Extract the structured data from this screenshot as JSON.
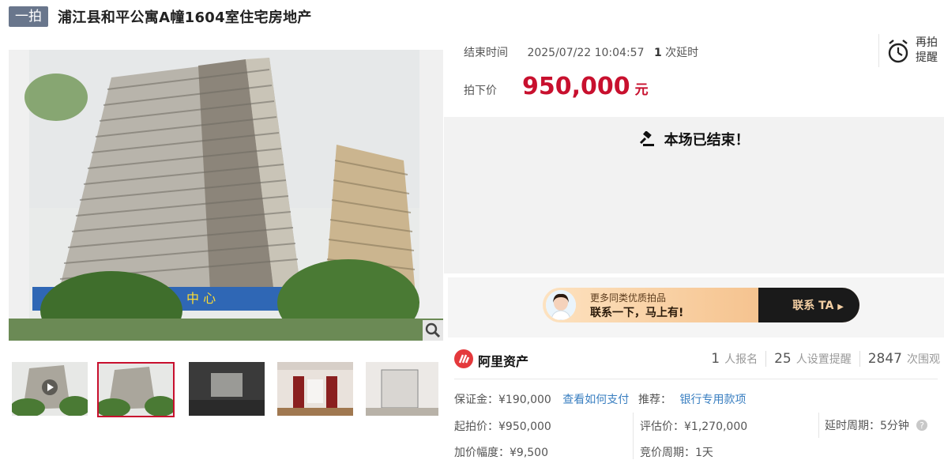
{
  "header": {
    "badge": "一拍",
    "title": "浦江县和平公寓A幢1604室住宅房地产"
  },
  "gallery": {
    "main_image": "building-photo",
    "thumbnail_count": 5,
    "active_thumbnail": 2
  },
  "auction": {
    "end_label": "结束时间",
    "end_time": "2025/07/22 10:04:57",
    "delay_count": "1",
    "delay_suffix": "次延时",
    "remind_label": "再拍提醒",
    "price_label": "拍下价",
    "price": "950,000",
    "price_unit": "元",
    "ended_text": "本场已结束！"
  },
  "promo": {
    "line1": "更多同类优质拍品",
    "line2": "联系一下，马上有!",
    "button": "联系 TA"
  },
  "platform": {
    "name": "阿里资产",
    "signups": "1",
    "signups_label": "人报名",
    "reminders": "25",
    "reminders_label": "人设置提醒",
    "views": "2847",
    "views_label": "次围观"
  },
  "details": {
    "deposit": "保证金：¥190,000",
    "deposit_link": "查看如何支付",
    "recommend_label": "推荐：",
    "recommend_link": "银行专用款项",
    "start_price": "起拍价：¥950,000",
    "appraisal": "评估价：¥1,270,000",
    "delay_period": "延时周期：5分钟",
    "increment": "加价幅度：¥9,500",
    "bid_period": "竞价周期：1天"
  },
  "colors": {
    "accent_red": "#c8102e",
    "badge_bg": "#69768c",
    "link_blue": "#3a7fc1"
  }
}
